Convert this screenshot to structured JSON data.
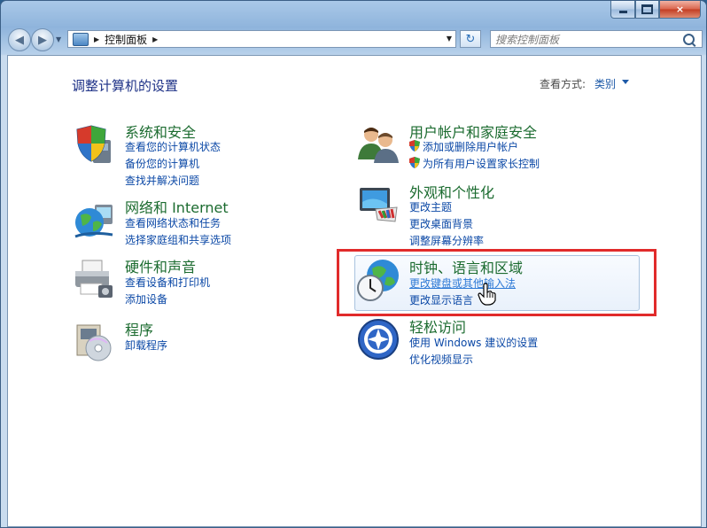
{
  "window": {
    "caption_buttons": {
      "close_glyph": "×"
    }
  },
  "toolbar": {
    "back_glyph": "◀",
    "forward_glyph": "▶",
    "address_path": "控制面板",
    "search_placeholder": "搜索控制面板",
    "refresh_glyph": "↻"
  },
  "header": {
    "title": "调整计算机的设置",
    "view_by_label": "查看方式:",
    "view_by_value": "类别"
  },
  "categories": {
    "system": {
      "title": "系统和安全",
      "icon": "shield-pc-icon",
      "links": [
        "查看您的计算机状态",
        "备份您的计算机",
        "查找并解决问题"
      ]
    },
    "network": {
      "title": "网络和 Internet",
      "icon": "globe-network-icon",
      "links": [
        "查看网络状态和任务",
        "选择家庭组和共享选项"
      ]
    },
    "hardware": {
      "title": "硬件和声音",
      "icon": "printer-icon",
      "links": [
        "查看设备和打印机",
        "添加设备"
      ]
    },
    "programs": {
      "title": "程序",
      "icon": "programs-disc-icon",
      "links": [
        "卸载程序"
      ]
    },
    "users": {
      "title": "用户帐户和家庭安全",
      "icon": "users-icon",
      "links": [
        "添加或删除用户帐户",
        "为所有用户设置家长控制"
      ]
    },
    "appearance": {
      "title": "外观和个性化",
      "icon": "monitor-palette-icon",
      "links": [
        "更改主题",
        "更改桌面背景",
        "调整屏幕分辨率"
      ]
    },
    "clock": {
      "title": "时钟、语言和区域",
      "icon": "globe-clock-icon",
      "links": [
        "更改键盘或其他输入法",
        "更改显示语言"
      ]
    },
    "ease": {
      "title": "轻松访问",
      "icon": "ease-of-access-icon",
      "links": [
        "使用 Windows 建议的设置",
        "优化视频显示"
      ]
    }
  },
  "colors": {
    "highlight_box": "#e12b2b",
    "category_title": "#1b6b2f",
    "link": "#0b48a6"
  }
}
